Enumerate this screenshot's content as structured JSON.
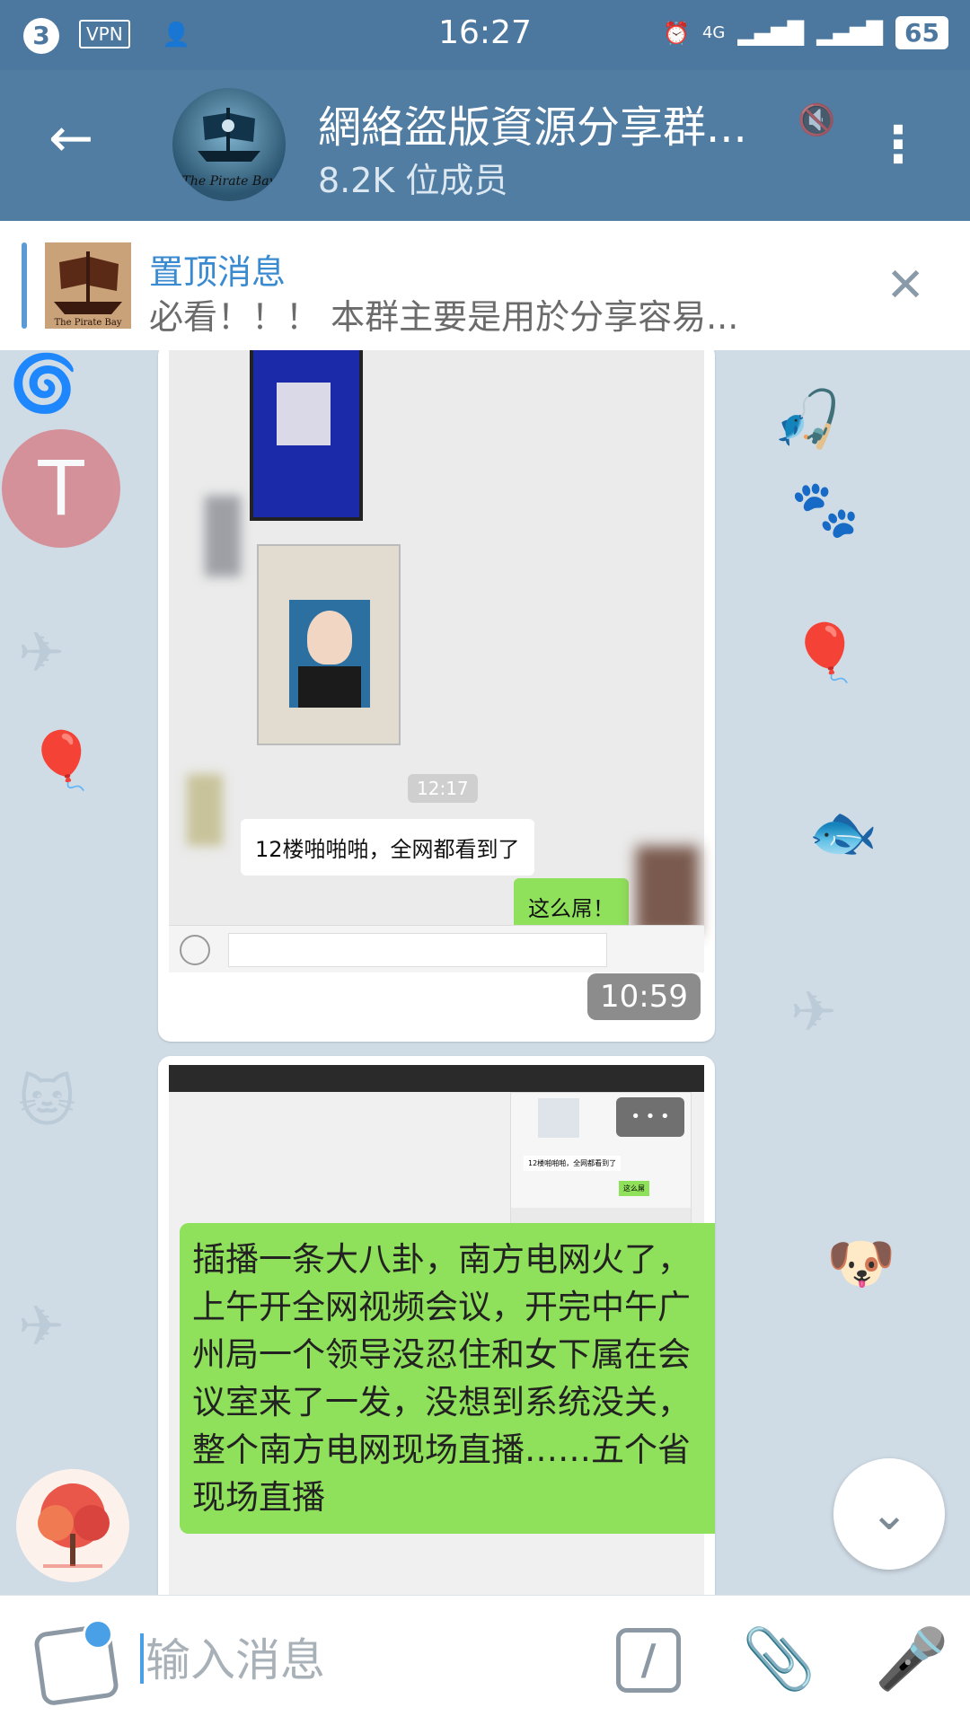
{
  "status_bar": {
    "notification_count": "3",
    "vpn": "VPN",
    "time": "16:27",
    "network": "4G",
    "battery": "65"
  },
  "header": {
    "title": "網絡盜版資源分享群...",
    "subtitle": "8.2K 位成员",
    "avatar_caption": "The Pirate Bay"
  },
  "pinned": {
    "label": "置顶消息",
    "text": "必看！！！ 本群主要是用於分享容易...",
    "thumb_caption": "The Pirate Bay"
  },
  "messages": [
    {
      "type": "image",
      "screenshot": {
        "timestamp": "12:17",
        "incoming_text": "12楼啪啪啪，全网都看到了",
        "outgoing_text": "这么屌！"
      },
      "time": "10:59"
    },
    {
      "type": "image",
      "mini_incoming": "12楼啪啪啪，全网都看到了",
      "mini_outgoing": "这么屌",
      "more": "• • •",
      "green_text": "插播一条大八卦，南方电网火了，上午开全网视频会议，开完中午广州局一个领导没忍住和女下属在会议室来了一发，没想到系统没关，整个南方电网现场直播……五个省现场直播"
    }
  ],
  "pinned_avatar_letter": "T",
  "input": {
    "placeholder": "输入消息",
    "command_symbol": "/"
  },
  "colors": {
    "header": "#517da2",
    "status_bar": "#4c78a0",
    "chat_bg": "#cfdbe5",
    "wechat_green": "#8fe05a",
    "accent": "#4aa0e6"
  }
}
